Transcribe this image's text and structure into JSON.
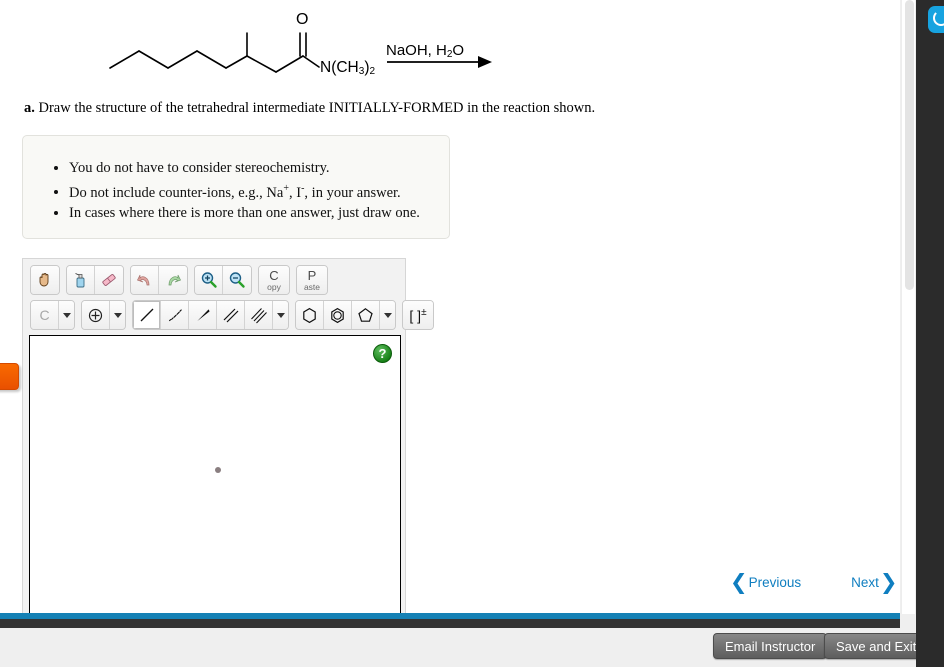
{
  "question": {
    "label": "a.",
    "text": "Draw the structure of the tetrahedral intermediate INITIALLY-FORMED in the reaction shown."
  },
  "reaction": {
    "reagents_line": "NaOH, H",
    "reagents_sub": "2",
    "reagents_tail": "O",
    "amide_n_label": "N(CH",
    "amide_n_sub": "3",
    "amide_n_tail": ")",
    "amide_n_sub2": "2",
    "carbonyl_o": "O",
    "arrow": "reaction-arrow",
    "structure_name": "3-methyl-N,N-dimethyloctanamide"
  },
  "notes": {
    "items": [
      {
        "pre": "You do not have to consider stereochemistry.",
        "sup": "",
        "post": ""
      },
      {
        "pre": "Do not include counter-ions, e.g., Na",
        "sup": "+",
        "mid": ", I",
        "sup2": "-",
        "post": ", in your answer."
      },
      {
        "pre": "In cases where there is more than one answer, just draw one.",
        "sup": "",
        "post": ""
      }
    ],
    "item1": "You do not have to consider stereochemistry.",
    "item3": "In cases where there is more than one answer, just draw one."
  },
  "sketcher": {
    "toolbar_row1": [
      {
        "name": "pan-tool",
        "glyph": "hand"
      },
      {
        "name": "clean-tool",
        "glyph": "spray"
      },
      {
        "name": "eraser-tool",
        "glyph": "eraser"
      },
      {
        "name": "undo-button",
        "glyph": "undo"
      },
      {
        "name": "redo-button",
        "glyph": "redo"
      },
      {
        "name": "zoom-in-button",
        "glyph": "zoom-in"
      },
      {
        "name": "zoom-out-button",
        "glyph": "zoom-out"
      }
    ],
    "copy_big": "C",
    "copy_small": "opy",
    "paste_big": "P",
    "paste_small": "aste",
    "element_label": "C",
    "charge_label": "⊕",
    "bracket_label": "[ ]",
    "bracket_sup": "±",
    "help_label": "?",
    "selected_tool": "single-bond"
  },
  "nav": {
    "previous": "Previous",
    "next": "Next",
    "chev_left": "❮",
    "chev_right": "❯"
  },
  "footer": {
    "email_instructor": "Email Instructor",
    "save_and_exit": "Save and Exit"
  },
  "colors": {
    "accent_blue": "#1581b5",
    "link_blue": "#0f7ec0",
    "orange_tab": "#f96a00",
    "help_green": "#167f16",
    "app_icon_blue": "#17a3e0"
  }
}
